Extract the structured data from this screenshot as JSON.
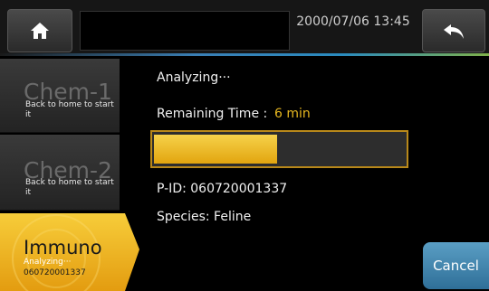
{
  "header": {
    "home_icon": "home-icon",
    "back_icon": "undo-arrow-icon",
    "datetime": "2000/07/06 13:45",
    "accent_gradient": [
      "#3a7fb5",
      "#7fb04a"
    ]
  },
  "sidebar": {
    "items": [
      {
        "name": "Chem-1",
        "sub": "Back to home to start it",
        "active": false
      },
      {
        "name": "Chem-2",
        "sub": "Back to home to start it",
        "active": false
      },
      {
        "name": "Immuno",
        "status": "Analyzing···",
        "pid": "060720001337",
        "active": true
      }
    ],
    "active_color": "#f0b418"
  },
  "main": {
    "status": "Analyzing···",
    "remaining_label": "Remaining Time :",
    "remaining_value": "6 min",
    "progress_fraction": 0.49,
    "progress_color": "#e8b820",
    "pid": "P-ID: 060720001337",
    "species": "Species: Feline"
  },
  "footer": {
    "cancel_label": "Cancel",
    "cancel_color": "#3f86b3"
  }
}
